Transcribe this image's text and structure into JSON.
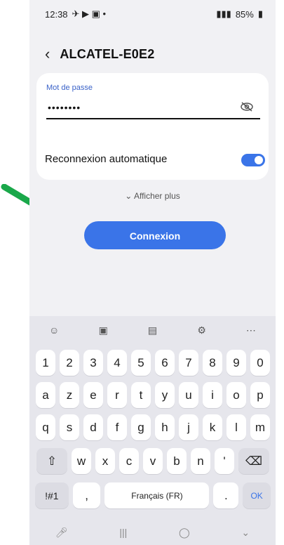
{
  "status_bar": {
    "time": "12:38",
    "battery": "85%"
  },
  "header": {
    "title": "ALCATEL-E0E2"
  },
  "password": {
    "label": "Mot de passe",
    "value": "••••••••"
  },
  "reconnect": {
    "label": "Reconnexion automatique",
    "enabled": true
  },
  "more": {
    "label": "⌄ Afficher plus"
  },
  "connect_button": {
    "label": "Connexion"
  },
  "keyboard": {
    "row1": [
      "1",
      "2",
      "3",
      "4",
      "5",
      "6",
      "7",
      "8",
      "9",
      "0"
    ],
    "row2": [
      "a",
      "z",
      "e",
      "r",
      "t",
      "y",
      "u",
      "i",
      "o",
      "p"
    ],
    "row3": [
      "q",
      "s",
      "d",
      "f",
      "g",
      "h",
      "j",
      "k",
      "l",
      "m"
    ],
    "row4": [
      "w",
      "x",
      "c",
      "v",
      "b",
      "n",
      "'"
    ],
    "symbols_label": "!#1",
    "comma": ",",
    "space_label": "Français (FR)",
    "period": ".",
    "ok_label": "OK"
  },
  "colors": {
    "accent": "#3a74e8",
    "highlight": "#e2131a",
    "arrow": "#1aa84a"
  }
}
